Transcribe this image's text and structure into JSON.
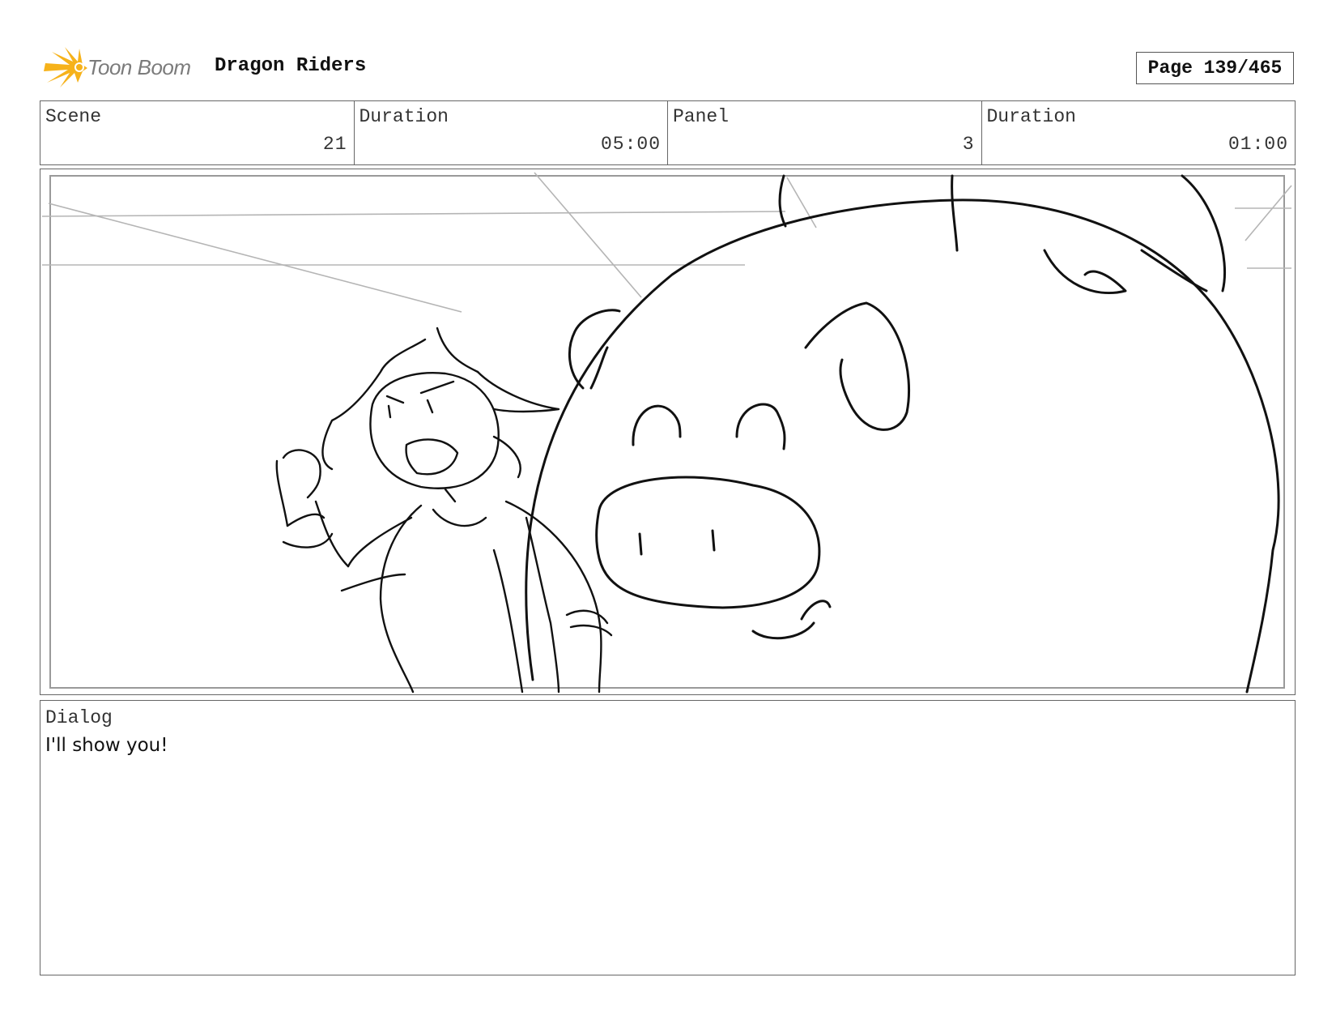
{
  "header": {
    "logo_text": "Toon Boom",
    "project_title": "Dragon Riders",
    "page_label": "Page 139/465"
  },
  "info": {
    "scene_label": "Scene",
    "scene_value": "21",
    "scene_duration_label": "Duration",
    "scene_duration_value": "05:00",
    "panel_label": "Panel",
    "panel_value": "3",
    "panel_duration_label": "Duration",
    "panel_duration_value": "01:00"
  },
  "dialog": {
    "label": "Dialog",
    "text": "I'll show you!"
  },
  "colors": {
    "logo_accent": "#f6b21a",
    "logo_text": "#7b7b7b",
    "border": "#666666"
  },
  "icons": {
    "logo": "toon-boom-starburst-icon"
  }
}
